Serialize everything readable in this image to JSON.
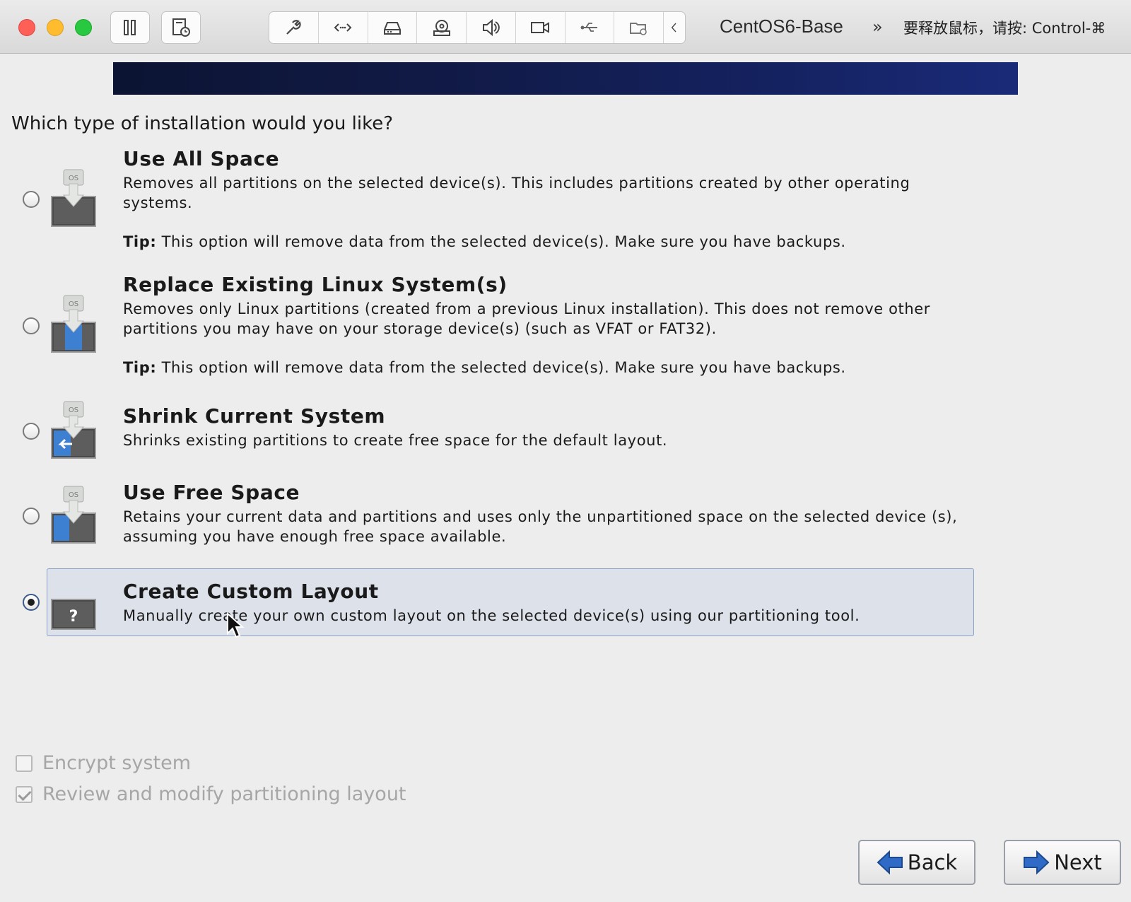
{
  "window": {
    "title": "CentOS6-Base",
    "more_chevron": "»",
    "release_hint": "要释放鼠标，请按: Control-⌘"
  },
  "toolbar": {
    "left_buttons": [
      "pause-icon",
      "snapshot-icon"
    ],
    "group_icons": [
      "wrench-icon",
      "network-icon",
      "harddisk-icon",
      "cdrom-icon",
      "speaker-icon",
      "camera-icon",
      "usb-icon",
      "shared-folder-icon",
      "chevron-left-icon"
    ]
  },
  "installer": {
    "question": "Which type of installation would you like?",
    "icon_os_label": "OS",
    "icon_custom_label": "?",
    "options": [
      {
        "title": "Use All Space",
        "desc": "Removes all partitions on the selected device(s).  This includes partitions created by other operating systems.",
        "tip_label": "Tip:",
        "tip_text": " This option will remove data from the selected device(s).  Make sure you have backups.",
        "selected": false
      },
      {
        "title": "Replace Existing Linux System(s)",
        "desc": "Removes only Linux partitions (created from a previous Linux installation).  This does not remove other partitions you may have on your storage device(s) (such as VFAT or FAT32).",
        "tip_label": "Tip:",
        "tip_text": " This option will remove data from the selected device(s).  Make sure you have backups.",
        "selected": false
      },
      {
        "title": "Shrink Current System",
        "desc": "Shrinks existing partitions to create free space for the default layout.",
        "selected": false
      },
      {
        "title": "Use Free Space",
        "desc": "Retains your current data and partitions and uses only the unpartitioned space on the selected device (s), assuming you have enough free space available.",
        "selected": false
      },
      {
        "title": "Create Custom Layout",
        "desc": "Manually create your own custom layout on the selected device(s) using our partitioning tool.",
        "selected": true
      }
    ],
    "encrypt": {
      "label": "Encrypt system",
      "checked": false,
      "enabled": false
    },
    "review": {
      "label": "Review and modify partitioning layout",
      "checked": true,
      "enabled": false
    },
    "back_label": "Back",
    "next_label": "Next"
  },
  "colors": {
    "banner": "#0c1433",
    "selection_bg": "#dde2ea",
    "selection_border": "#8aa0c4",
    "arrow_blue": "#2f6bc6"
  }
}
